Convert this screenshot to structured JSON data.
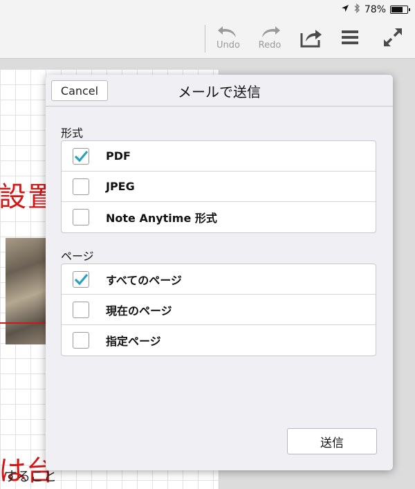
{
  "status": {
    "battery_percent": "78%",
    "battery_level": 0.78
  },
  "toolbar": {
    "undo_label": "Undo",
    "redo_label": "Redo"
  },
  "note": {
    "handwriting_top": "設置",
    "handwriting_bottom": "は台",
    "text": "すること"
  },
  "dialog": {
    "title": "メールで送信",
    "cancel_label": "Cancel",
    "send_label": "送信",
    "format": {
      "label": "形式",
      "options": [
        {
          "label": "PDF",
          "checked": true
        },
        {
          "label": "JPEG",
          "checked": false
        },
        {
          "label": "Note Anytime 形式",
          "checked": false
        }
      ]
    },
    "pages": {
      "label": "ページ",
      "options": [
        {
          "label": "すべてのページ",
          "checked": true
        },
        {
          "label": "現在のページ",
          "checked": false
        },
        {
          "label": "指定ページ",
          "checked": false
        }
      ]
    }
  },
  "colors": {
    "check": "#2a9fc2",
    "handwriting": "#d01818"
  }
}
